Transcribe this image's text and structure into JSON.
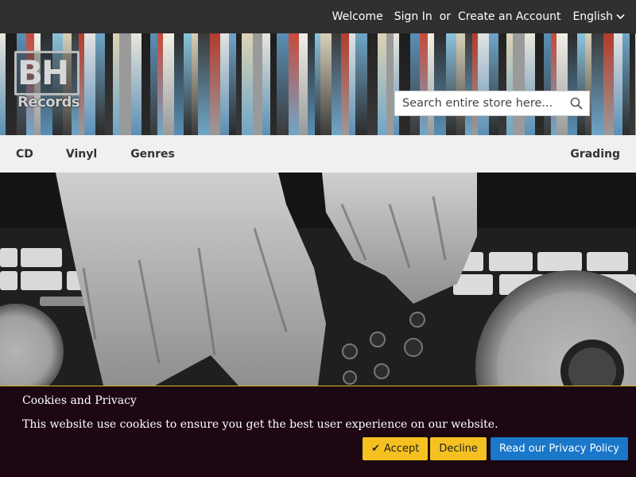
{
  "topbar": {
    "welcome": "Welcome",
    "sign_in": "Sign In",
    "or": "or",
    "create_account": "Create an Account",
    "language": "English"
  },
  "logo": {
    "mark": "BH",
    "word": "Records"
  },
  "search": {
    "placeholder": "Search entire store here..."
  },
  "nav": {
    "items": [
      "CD",
      "Vinyl",
      "Genres"
    ],
    "right_item": "Grading"
  },
  "cookie": {
    "title": "Cookies and Privacy",
    "message": "This website use cookies to ensure you get the best user experience on our website.",
    "accept": "Accept",
    "decline": "Decline",
    "policy": "Read our Privacy Policy"
  },
  "colors": {
    "topbar": "#303030",
    "nav_bg": "#f0f0f0",
    "cookie_bg": "#1c0712",
    "accent_yellow": "#f5c121",
    "accent_blue": "#1a77c9"
  }
}
